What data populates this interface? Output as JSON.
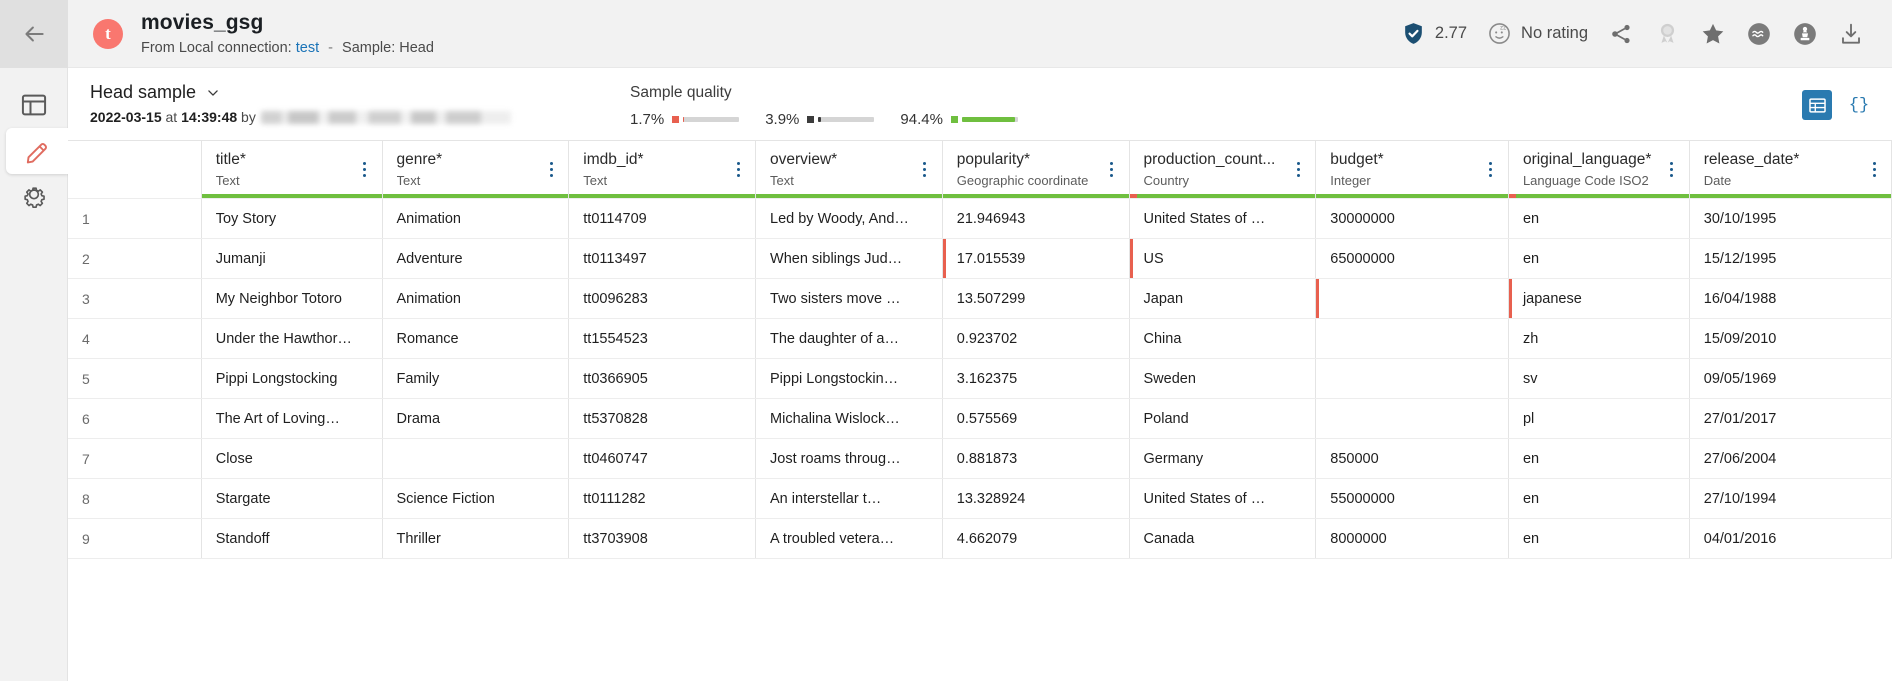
{
  "header": {
    "back_label": "Back",
    "dataset_initial": "t",
    "title": "movies_gsg",
    "subtitle_prefix": "From Local connection:",
    "connection_name": "test",
    "separator": "-",
    "sample_text": "Sample: Head",
    "quality_score": "2.77",
    "rating_text": "No rating",
    "icons": {
      "shield": "shield-check-icon",
      "rating": "sleeping-face-icon",
      "share": "share-icon",
      "certify": "certification-badge-icon",
      "favorite": "star-icon",
      "semantic": "wave-circle-icon",
      "dataquality": "chess-piece-circle-icon",
      "download": "download-icon"
    }
  },
  "sidebar": {
    "items": [
      {
        "name": "sidebar-item-dataset",
        "icon": "table-layout-icon",
        "active": false
      },
      {
        "name": "sidebar-item-preparation",
        "icon": "pencil-icon",
        "active": true
      },
      {
        "name": "sidebar-item-settings",
        "icon": "gear-icon",
        "active": false
      }
    ]
  },
  "sample": {
    "title": "Head sample",
    "date": "2022-03-15",
    "at_label": "at",
    "time": "14:39:48",
    "by_label": "by",
    "author_redacted": true,
    "quality_label": "Sample quality",
    "quality_items": [
      {
        "label": "1.7%",
        "color": "#e8604f",
        "fill_pct": 1.7
      },
      {
        "label": "3.9%",
        "color": "#3c3c3c",
        "fill_pct": 3.9
      },
      {
        "label": "94.4%",
        "color": "#6fbf3f",
        "fill_pct": 94.4
      }
    ],
    "view_grid": "grid-view-icon",
    "view_json": "{}"
  },
  "table": {
    "rownum_header": "",
    "columns": [
      {
        "name": "title*",
        "type": "Text",
        "bar": [
          {
            "color": "#6fbf3f",
            "pct": 100
          }
        ]
      },
      {
        "name": "genre*",
        "type": "Text",
        "bar": [
          {
            "color": "#6fbf3f",
            "pct": 100
          }
        ]
      },
      {
        "name": "imdb_id*",
        "type": "Text",
        "bar": [
          {
            "color": "#6fbf3f",
            "pct": 100
          }
        ]
      },
      {
        "name": "overview*",
        "type": "Text",
        "bar": [
          {
            "color": "#6fbf3f",
            "pct": 100
          }
        ]
      },
      {
        "name": "popularity*",
        "type": "Geographic coordinate",
        "bar": [
          {
            "color": "#6fbf3f",
            "pct": 100
          }
        ]
      },
      {
        "name": "production_count...",
        "type": "Country",
        "bar": [
          {
            "color": "#e8604f",
            "pct": 4
          },
          {
            "color": "#6fbf3f",
            "pct": 96
          }
        ]
      },
      {
        "name": "budget*",
        "type": "Integer",
        "bar": [
          {
            "color": "#6fbf3f",
            "pct": 100
          }
        ]
      },
      {
        "name": "original_language*",
        "type": "Language Code ISO2",
        "bar": [
          {
            "color": "#e8604f",
            "pct": 4
          },
          {
            "color": "#6fbf3f",
            "pct": 96
          }
        ]
      },
      {
        "name": "release_date*",
        "type": "Date",
        "bar": [
          {
            "color": "#6fbf3f",
            "pct": 100
          }
        ]
      }
    ],
    "rows": [
      {
        "n": "1",
        "cells": [
          "Toy Story",
          "Animation",
          "tt0114709",
          "Led by Woody, And…",
          "21.946943",
          "United States of …",
          "30000000",
          "en",
          "30/10/1995"
        ],
        "invalid": []
      },
      {
        "n": "2",
        "cells": [
          "Jumanji",
          "Adventure",
          "tt0113497",
          "When siblings Jud…",
          "17.015539",
          "US",
          "65000000",
          "en",
          "15/12/1995"
        ],
        "invalid": [
          5
        ]
      },
      {
        "n": "3",
        "cells": [
          "My Neighbor Totoro",
          "Animation",
          "tt0096283",
          "Two sisters move …",
          "13.507299",
          "Japan",
          "",
          "japanese",
          "16/04/1988"
        ],
        "invalid": [
          7
        ]
      },
      {
        "n": "4",
        "cells": [
          "Under the Hawthor…",
          "Romance",
          "tt1554523",
          "The daughter of a…",
          "0.923702",
          "China",
          "",
          "zh",
          "15/09/2010"
        ],
        "invalid": []
      },
      {
        "n": "5",
        "cells": [
          "Pippi Longstocking",
          "Family",
          "tt0366905",
          "Pippi Longstockin…",
          "3.162375",
          "Sweden",
          "",
          "sv",
          "09/05/1969"
        ],
        "invalid": []
      },
      {
        "n": "6",
        "cells": [
          "The Art of Loving…",
          "Drama",
          "tt5370828",
          "Michalina Wislock…",
          "0.575569",
          "Poland",
          "",
          "pl",
          "27/01/2017"
        ],
        "invalid": []
      },
      {
        "n": "7",
        "cells": [
          "Close",
          "",
          "tt0460747",
          "Jost roams throug…",
          "0.881873",
          "Germany",
          "850000",
          "en",
          "27/06/2004"
        ],
        "invalid": []
      },
      {
        "n": "8",
        "cells": [
          "Stargate",
          "Science Fiction",
          "tt0111282",
          "An interstellar t…",
          "13.328924",
          "United States of …",
          "55000000",
          "en",
          "27/10/1994"
        ],
        "invalid": []
      },
      {
        "n": "9",
        "cells": [
          "Standoff",
          "Thriller",
          "tt3703908",
          "A troubled vetera…",
          "4.662079",
          "Canada",
          "8000000",
          "en",
          "04/01/2016"
        ],
        "invalid": []
      }
    ]
  }
}
